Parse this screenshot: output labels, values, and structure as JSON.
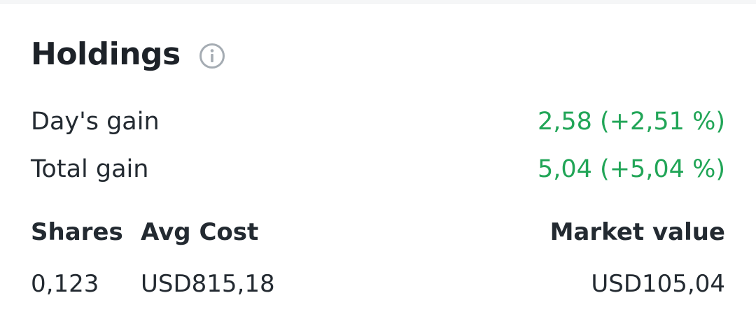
{
  "holdings": {
    "title": "Holdings",
    "info_icon": "info-circle-icon",
    "days_gain": {
      "label": "Day's gain",
      "value": "2,58 (+2,51 %)"
    },
    "total_gain": {
      "label": "Total gain",
      "value": "5,04 (+5,04 %)"
    },
    "columns": {
      "shares": "Shares",
      "avg_cost": "Avg Cost",
      "market_value": "Market value"
    },
    "values": {
      "shares": "0,123",
      "avg_cost": "USD815,18",
      "market_value": "USD105,04"
    }
  },
  "colors": {
    "gain": "#21a557",
    "text": "#232a31",
    "icon": "#a5acb3"
  }
}
